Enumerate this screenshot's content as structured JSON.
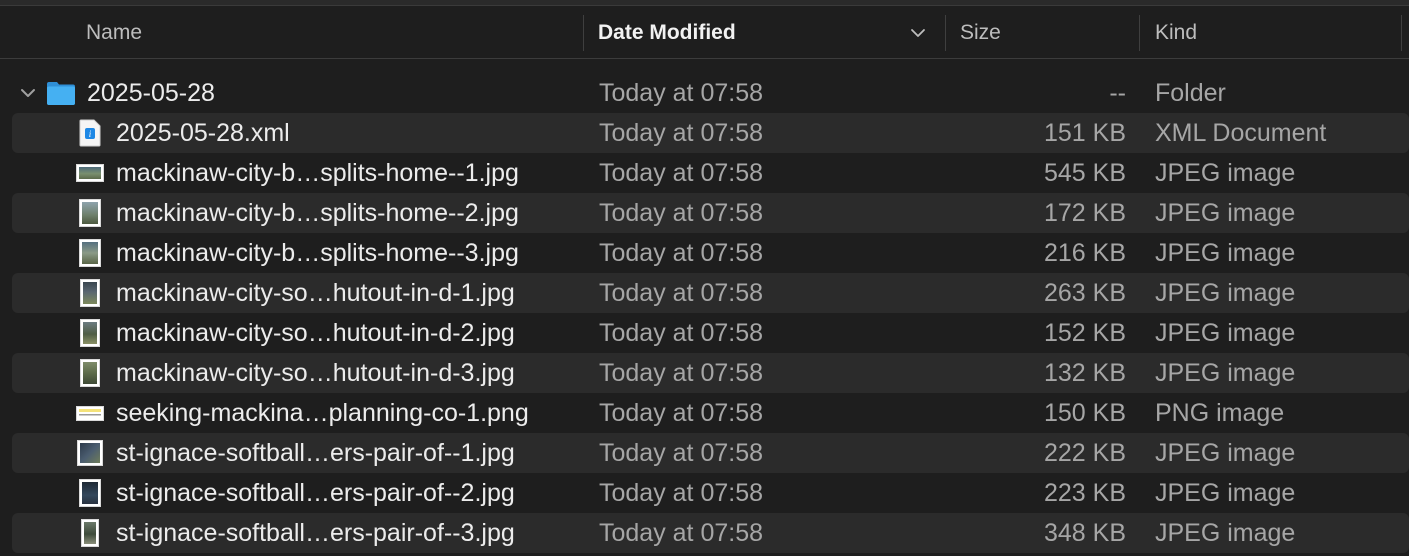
{
  "columns": {
    "name": "Name",
    "date_modified": "Date Modified",
    "size": "Size",
    "kind": "Kind"
  },
  "sort_indicator": "chevron-down-icon",
  "folder": {
    "name": "2025-05-28",
    "date": "Today at 07:58",
    "size": "--",
    "kind": "Folder",
    "icon": "folder-icon",
    "color": "#3fa9f5"
  },
  "files": [
    {
      "name": "2025-05-28.xml",
      "date": "Today at 07:58",
      "size": "151 KB",
      "kind": "XML Document",
      "icon": "xml-file-icon"
    },
    {
      "name": "mackinaw-city-b…splits-home--1.jpg",
      "date": "Today at 07:58",
      "size": "545 KB",
      "kind": "JPEG image",
      "icon": "jpeg-thumbnail-icon"
    },
    {
      "name": "mackinaw-city-b…splits-home--2.jpg",
      "date": "Today at 07:58",
      "size": "172 KB",
      "kind": "JPEG image",
      "icon": "jpeg-thumbnail-icon"
    },
    {
      "name": "mackinaw-city-b…splits-home--3.jpg",
      "date": "Today at 07:58",
      "size": "216 KB",
      "kind": "JPEG image",
      "icon": "jpeg-thumbnail-icon"
    },
    {
      "name": "mackinaw-city-so…hutout-in-d-1.jpg",
      "date": "Today at 07:58",
      "size": "263 KB",
      "kind": "JPEG image",
      "icon": "jpeg-thumbnail-icon"
    },
    {
      "name": "mackinaw-city-so…hutout-in-d-2.jpg",
      "date": "Today at 07:58",
      "size": "152 KB",
      "kind": "JPEG image",
      "icon": "jpeg-thumbnail-icon"
    },
    {
      "name": "mackinaw-city-so…hutout-in-d-3.jpg",
      "date": "Today at 07:58",
      "size": "132 KB",
      "kind": "JPEG image",
      "icon": "jpeg-thumbnail-icon"
    },
    {
      "name": "seeking-mackina…planning-co-1.png",
      "date": "Today at 07:58",
      "size": "150 KB",
      "kind": "PNG image",
      "icon": "png-thumbnail-icon"
    },
    {
      "name": "st-ignace-softball…ers-pair-of--1.jpg",
      "date": "Today at 07:58",
      "size": "222 KB",
      "kind": "JPEG image",
      "icon": "jpeg-thumbnail-icon"
    },
    {
      "name": "st-ignace-softball…ers-pair-of--2.jpg",
      "date": "Today at 07:58",
      "size": "223 KB",
      "kind": "JPEG image",
      "icon": "jpeg-thumbnail-icon"
    },
    {
      "name": "st-ignace-softball…ers-pair-of--3.jpg",
      "date": "Today at 07:58",
      "size": "348 KB",
      "kind": "JPEG image",
      "icon": "jpeg-thumbnail-icon"
    }
  ]
}
